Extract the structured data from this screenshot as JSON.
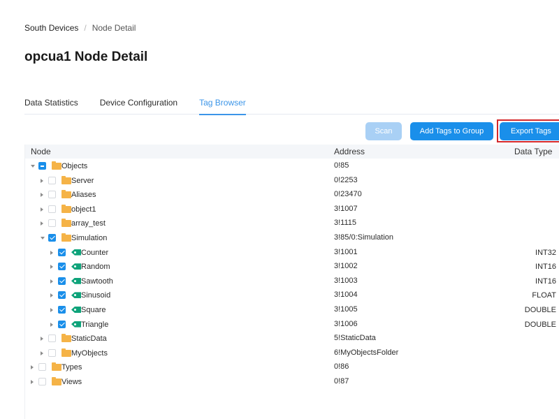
{
  "breadcrumb": {
    "parent": "South Devices",
    "separator": "/",
    "current": "Node Detail"
  },
  "page_title": "opcua1 Node Detail",
  "tabs": [
    {
      "label": "Data Statistics",
      "active": false
    },
    {
      "label": "Device Configuration",
      "active": false
    },
    {
      "label": "Tag Browser",
      "active": true
    }
  ],
  "toolbar": {
    "scan_label": "Scan",
    "add_tags_label": "Add Tags to Group",
    "export_tags_label": "Export Tags"
  },
  "table": {
    "headers": {
      "node": "Node",
      "address": "Address",
      "data_type": "Data Type"
    },
    "rows": [
      {
        "name": "Objects",
        "address": "0!85",
        "data_type": "",
        "level": 0,
        "kind": "folder",
        "expanded": true,
        "check": "partial"
      },
      {
        "name": "Server",
        "address": "0!2253",
        "data_type": "",
        "level": 1,
        "kind": "folder",
        "expanded": false,
        "check": "none"
      },
      {
        "name": "Aliases",
        "address": "0!23470",
        "data_type": "",
        "level": 1,
        "kind": "folder",
        "expanded": false,
        "check": "none"
      },
      {
        "name": "object1",
        "address": "3!1007",
        "data_type": "",
        "level": 1,
        "kind": "folder",
        "expanded": false,
        "check": "none"
      },
      {
        "name": "array_test",
        "address": "3!1115",
        "data_type": "",
        "level": 1,
        "kind": "folder",
        "expanded": false,
        "check": "none"
      },
      {
        "name": "Simulation",
        "address": "3!85/0:Simulation",
        "data_type": "",
        "level": 1,
        "kind": "folder",
        "expanded": true,
        "check": "checked"
      },
      {
        "name": "Counter",
        "address": "3!1001",
        "data_type": "INT32",
        "level": 2,
        "kind": "tag",
        "expanded": false,
        "check": "checked"
      },
      {
        "name": "Random",
        "address": "3!1002",
        "data_type": "INT16",
        "level": 2,
        "kind": "tag",
        "expanded": false,
        "check": "checked"
      },
      {
        "name": "Sawtooth",
        "address": "3!1003",
        "data_type": "INT16",
        "level": 2,
        "kind": "tag",
        "expanded": false,
        "check": "checked"
      },
      {
        "name": "Sinusoid",
        "address": "3!1004",
        "data_type": "FLOAT",
        "level": 2,
        "kind": "tag",
        "expanded": false,
        "check": "checked"
      },
      {
        "name": "Square",
        "address": "3!1005",
        "data_type": "DOUBLE",
        "level": 2,
        "kind": "tag",
        "expanded": false,
        "check": "checked"
      },
      {
        "name": "Triangle",
        "address": "3!1006",
        "data_type": "DOUBLE",
        "level": 2,
        "kind": "tag",
        "expanded": false,
        "check": "checked"
      },
      {
        "name": "StaticData",
        "address": "5!StaticData",
        "data_type": "",
        "level": 1,
        "kind": "folder",
        "expanded": false,
        "check": "none"
      },
      {
        "name": "MyObjects",
        "address": "6!MyObjectsFolder",
        "data_type": "",
        "level": 1,
        "kind": "folder",
        "expanded": false,
        "check": "none"
      },
      {
        "name": "Types",
        "address": "0!86",
        "data_type": "",
        "level": 0,
        "kind": "folder",
        "expanded": false,
        "check": "none"
      },
      {
        "name": "Views",
        "address": "0!87",
        "data_type": "",
        "level": 0,
        "kind": "folder",
        "expanded": false,
        "check": "none"
      }
    ]
  },
  "colors": {
    "accent": "#1a8fea",
    "disabled_button": "#a9d0f5",
    "highlight": "#d4282b",
    "folder": "#f5b347",
    "tag": "#0ea37a"
  }
}
